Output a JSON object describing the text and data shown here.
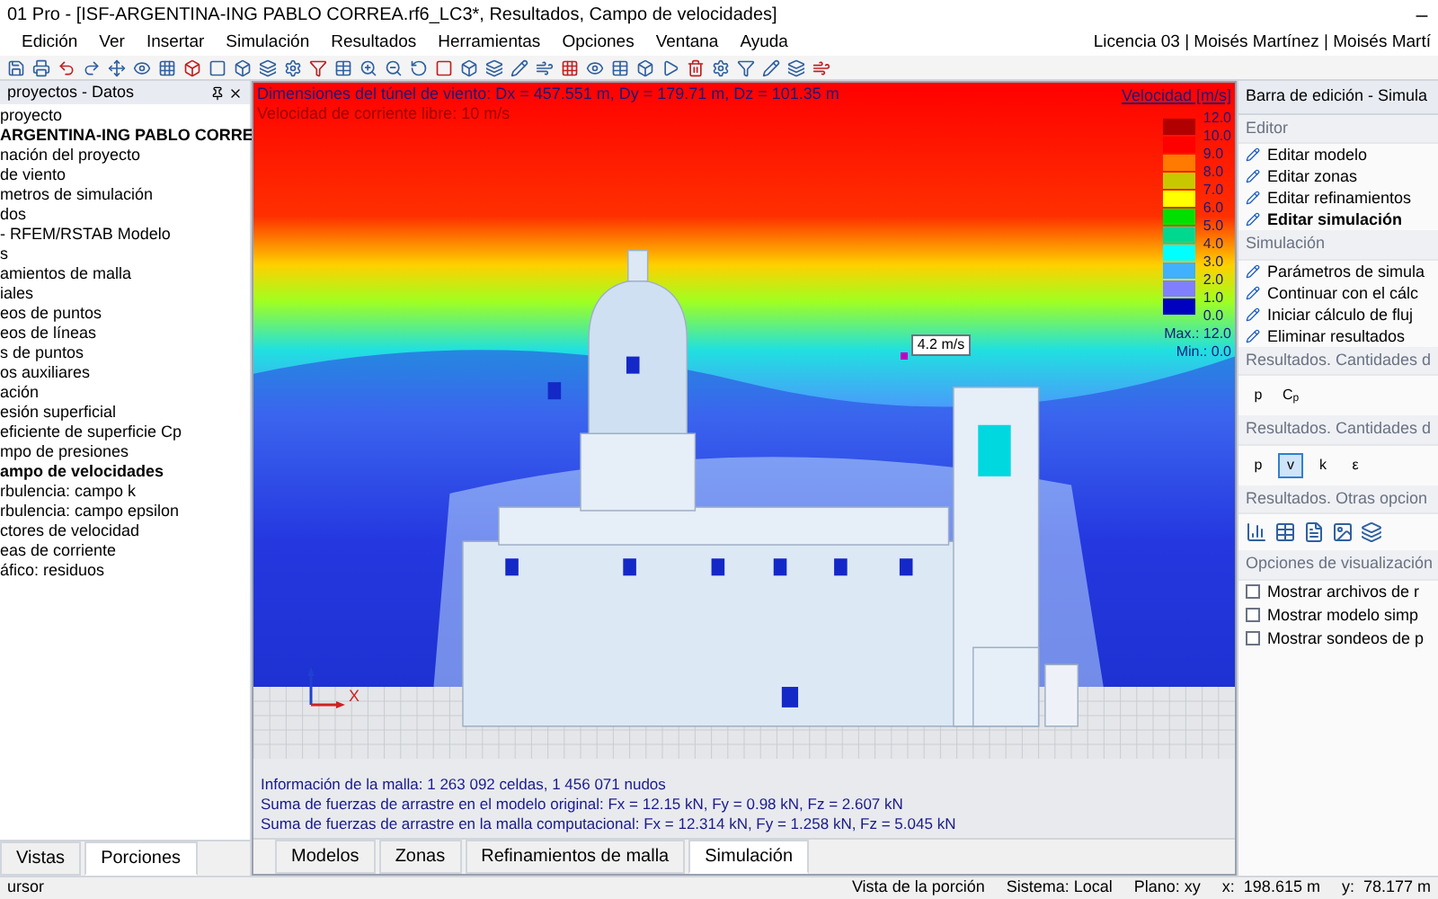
{
  "window": {
    "title": "01 Pro - [ISF-ARGENTINA-ING PABLO CORREA.rf6_LC3*, Resultados, Campo de velocidades]"
  },
  "menu": [
    "Edición",
    "Ver",
    "Insertar",
    "Simulación",
    "Resultados",
    "Herramientas",
    "Opciones",
    "Ventana",
    "Ayuda"
  ],
  "license": "Licencia 03 | Moisés Martínez | Moisés Martí",
  "navigator": {
    "title": "proyectos - Datos",
    "items": [
      {
        "label": "proyecto",
        "bold": false
      },
      {
        "label": "ARGENTINA-ING PABLO CORRE",
        "bold": true
      },
      {
        "label": "nación del proyecto",
        "bold": false
      },
      {
        "label": "de viento",
        "bold": false
      },
      {
        "label": "metros de simulación",
        "bold": false
      },
      {
        "label": "dos",
        "bold": false
      },
      {
        "label": "- RFEM/RSTAB Modelo",
        "bold": false
      },
      {
        "label": "s",
        "bold": false
      },
      {
        "label": "amientos de malla",
        "bold": false
      },
      {
        "label": "iales",
        "bold": false
      },
      {
        "label": "eos de puntos",
        "bold": false
      },
      {
        "label": "eos de líneas",
        "bold": false
      },
      {
        "label": "s de puntos",
        "bold": false
      },
      {
        "label": "os auxiliares",
        "bold": false
      },
      {
        "label": "ación",
        "bold": false
      },
      {
        "label": "esión superficial",
        "bold": false
      },
      {
        "label": "eficiente de superficie Cp",
        "bold": false
      },
      {
        "label": "mpo de presiones",
        "bold": false
      },
      {
        "label": "ampo de velocidades",
        "bold": true
      },
      {
        "label": "rbulencia: campo k",
        "bold": false
      },
      {
        "label": "rbulencia: campo epsilon",
        "bold": false
      },
      {
        "label": "ctores de velocidad",
        "bold": false
      },
      {
        "label": "eas de corriente",
        "bold": false
      },
      {
        "label": "áfico: residuos",
        "bold": false
      }
    ],
    "tabs": [
      {
        "label": "Vistas",
        "selected": false
      },
      {
        "label": "Porciones",
        "selected": true
      }
    ]
  },
  "viewport": {
    "dimensions": "Dimensiones del túnel de viento: Dx = 457.551 m, Dy = 179.71 m, Dz = 101.35 m",
    "free_stream": "Velocidad de corriente libre: 10 m/s",
    "probe": "4.2 m/s",
    "axis_label": "X",
    "legend": {
      "title": "Velocidad [m/s]",
      "entries": [
        {
          "label": "12.0",
          "color": "#b00000"
        },
        {
          "label": "10.0",
          "color": "#ff0000"
        },
        {
          "label": "9.0",
          "color": "#ff7a00"
        },
        {
          "label": "8.0",
          "color": "#c8c800"
        },
        {
          "label": "7.0",
          "color": "#ffff00"
        },
        {
          "label": "6.0",
          "color": "#00e000"
        },
        {
          "label": "5.0",
          "color": "#00d890"
        },
        {
          "label": "4.0",
          "color": "#00ffff"
        },
        {
          "label": "3.0",
          "color": "#40b0ff"
        },
        {
          "label": "2.0",
          "color": "#8080ff"
        },
        {
          "label": "1.0",
          "color": "#0000c0"
        }
      ],
      "bottom_label": "0.0",
      "max": "Max.: 12.0",
      "min": "Min.: 0.0"
    },
    "info": [
      "Información de la malla: 1 263 092 celdas, 1 456 071 nudos",
      "Suma de fuerzas de arrastre en el modelo original: Fx = 12.15 kN, Fy = 0.98 kN, Fz = 2.607 kN",
      "Suma de fuerzas de arrastre en la malla computacional: Fx = 12.314 kN, Fy = 1.258 kN, Fz = 5.045 kN"
    ],
    "tabs": [
      {
        "label": "Modelos",
        "selected": false
      },
      {
        "label": "Zonas",
        "selected": false
      },
      {
        "label": "Refinamientos de malla",
        "selected": false
      },
      {
        "label": "Simulación",
        "selected": true
      }
    ]
  },
  "panel": {
    "title": "Barra de edición - Simula",
    "sections": [
      {
        "title": "Editor",
        "kind": "list",
        "items": [
          {
            "label": "Editar modelo",
            "bold": false
          },
          {
            "label": "Editar zonas",
            "bold": false
          },
          {
            "label": "Editar refinamientos",
            "bold": false
          },
          {
            "label": "Editar simulación",
            "bold": true
          }
        ]
      },
      {
        "title": "Simulación",
        "kind": "list",
        "items": [
          {
            "label": "Parámetros de simula",
            "bold": false
          },
          {
            "label": "Continuar con el cálc",
            "bold": false
          },
          {
            "label": "Iniciar cálculo de fluj",
            "bold": false
          },
          {
            "label": "Eliminar resultados",
            "bold": false
          }
        ]
      },
      {
        "title": "Resultados. Cantidades d",
        "kind": "buttons",
        "buttons": [
          {
            "label": "p",
            "selected": false
          },
          {
            "label": "C$_{p}$",
            "selected": false
          }
        ]
      },
      {
        "title": "Resultados. Cantidades d",
        "kind": "buttons",
        "buttons": [
          {
            "label": "p",
            "selected": false
          },
          {
            "label": "v",
            "selected": true
          },
          {
            "label": "k",
            "selected": false
          },
          {
            "label": "ε",
            "selected": false
          }
        ]
      },
      {
        "title": "Resultados. Otras opcion",
        "kind": "icons"
      },
      {
        "title": "Opciones de visualización",
        "kind": "checks",
        "items": [
          {
            "label": "Mostrar archivos de r",
            "checked": false
          },
          {
            "label": "Mostrar modelo simp",
            "checked": false
          },
          {
            "label": "Mostrar sondeos de p",
            "checked": false
          }
        ]
      }
    ]
  },
  "status_bar": {
    "left": "ursor",
    "fields": [
      "Vista de la porción",
      "Sistema: Local",
      "Plano: xy",
      "x:  198.615 m",
      "y:  78.177 m"
    ]
  }
}
